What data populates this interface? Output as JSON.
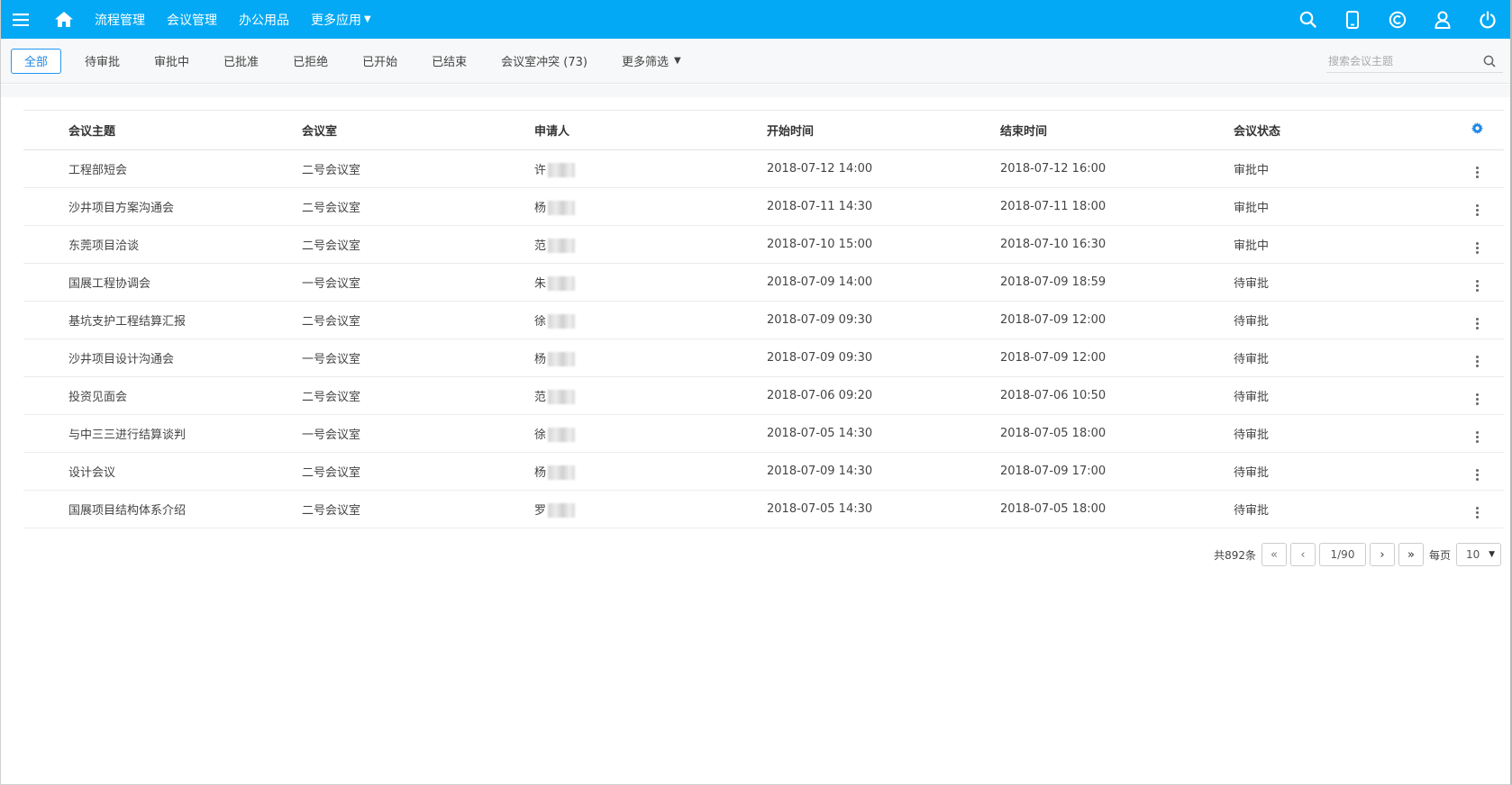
{
  "topbar": {
    "nav": [
      {
        "label": "流程管理"
      },
      {
        "label": "会议管理"
      },
      {
        "label": "办公用品"
      },
      {
        "label": "更多应用"
      }
    ],
    "icons": [
      "search-icon",
      "mobile-icon",
      "copyright-icon",
      "user-icon",
      "power-icon"
    ],
    "bg_color": "#03a9f4"
  },
  "filters": {
    "tabs": [
      {
        "label": "全部",
        "active": true
      },
      {
        "label": "待审批"
      },
      {
        "label": "审批中"
      },
      {
        "label": "已批准"
      },
      {
        "label": "已拒绝"
      },
      {
        "label": "已开始"
      },
      {
        "label": "已结束"
      },
      {
        "label": "会议室冲突 (73)"
      },
      {
        "label": "更多筛选"
      }
    ],
    "search_placeholder": "搜索会议主题"
  },
  "table": {
    "headers": [
      "会议主题",
      "会议室",
      "申请人",
      "开始时间",
      "结束时间",
      "会议状态"
    ],
    "rows": [
      {
        "topic": "工程部短会",
        "room": "二号会议室",
        "applicant": "许",
        "start": "2018-07-12 14:00",
        "end": "2018-07-12 16:00",
        "status": "审批中"
      },
      {
        "topic": "沙井项目方案沟通会",
        "room": "二号会议室",
        "applicant": "杨",
        "start": "2018-07-11 14:30",
        "end": "2018-07-11 18:00",
        "status": "审批中"
      },
      {
        "topic": "东莞项目洽谈",
        "room": "二号会议室",
        "applicant": "范",
        "start": "2018-07-10 15:00",
        "end": "2018-07-10 16:30",
        "status": "审批中"
      },
      {
        "topic": "国展工程协调会",
        "room": "一号会议室",
        "applicant": "朱",
        "start": "2018-07-09 14:00",
        "end": "2018-07-09 18:59",
        "status": "待审批"
      },
      {
        "topic": "基坑支护工程结算汇报",
        "room": "二号会议室",
        "applicant": "徐",
        "start": "2018-07-09 09:30",
        "end": "2018-07-09 12:00",
        "status": "待审批"
      },
      {
        "topic": "沙井项目设计沟通会",
        "room": "一号会议室",
        "applicant": "杨",
        "start": "2018-07-09 09:30",
        "end": "2018-07-09 12:00",
        "status": "待审批"
      },
      {
        "topic": "投资见面会",
        "room": "二号会议室",
        "applicant": "范",
        "start": "2018-07-06 09:20",
        "end": "2018-07-06 10:50",
        "status": "待审批"
      },
      {
        "topic": "与中三三进行结算谈判",
        "room": "一号会议室",
        "applicant": "徐",
        "start": "2018-07-05 14:30",
        "end": "2018-07-05 18:00",
        "status": "待审批"
      },
      {
        "topic": "设计会议",
        "room": "二号会议室",
        "applicant": "杨",
        "start": "2018-07-09 14:30",
        "end": "2018-07-09 17:00",
        "status": "待审批"
      },
      {
        "topic": "国展项目结构体系介绍",
        "room": "二号会议室",
        "applicant": "罗",
        "start": "2018-07-05 14:30",
        "end": "2018-07-05 18:00",
        "status": "待审批"
      }
    ]
  },
  "pagination": {
    "total": "共892条",
    "page": "1/90",
    "per_page_label": "每页",
    "page_size": "10"
  }
}
